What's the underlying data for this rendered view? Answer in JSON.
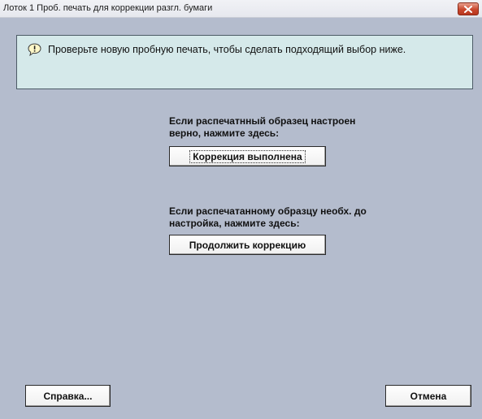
{
  "window": {
    "title": "Лоток 1 Проб. печать для коррекции разгл. бумаги"
  },
  "icons": {
    "close": "close-icon",
    "info": "speech-bubble-info-icon"
  },
  "info": {
    "message": "Проверьте новую пробную печать, чтобы сделать подходящий выбор ниже."
  },
  "section1": {
    "prompt_line1": "Если распечатнный образец настроен",
    "prompt_line2": "верно, нажмите здесь:",
    "button_label": "Коррекция выполнена"
  },
  "section2": {
    "prompt_line1": "Если распечатанному образцу необх. до",
    "prompt_line2": "настройка, нажмите здесь:",
    "button_label": "Продолжить коррекцию"
  },
  "footer": {
    "help_label": "Справка...",
    "cancel_label": "Отмена"
  },
  "colors": {
    "background": "#b4bccd",
    "info_panel": "#d5e9ea",
    "close_button": "#c9472d"
  }
}
